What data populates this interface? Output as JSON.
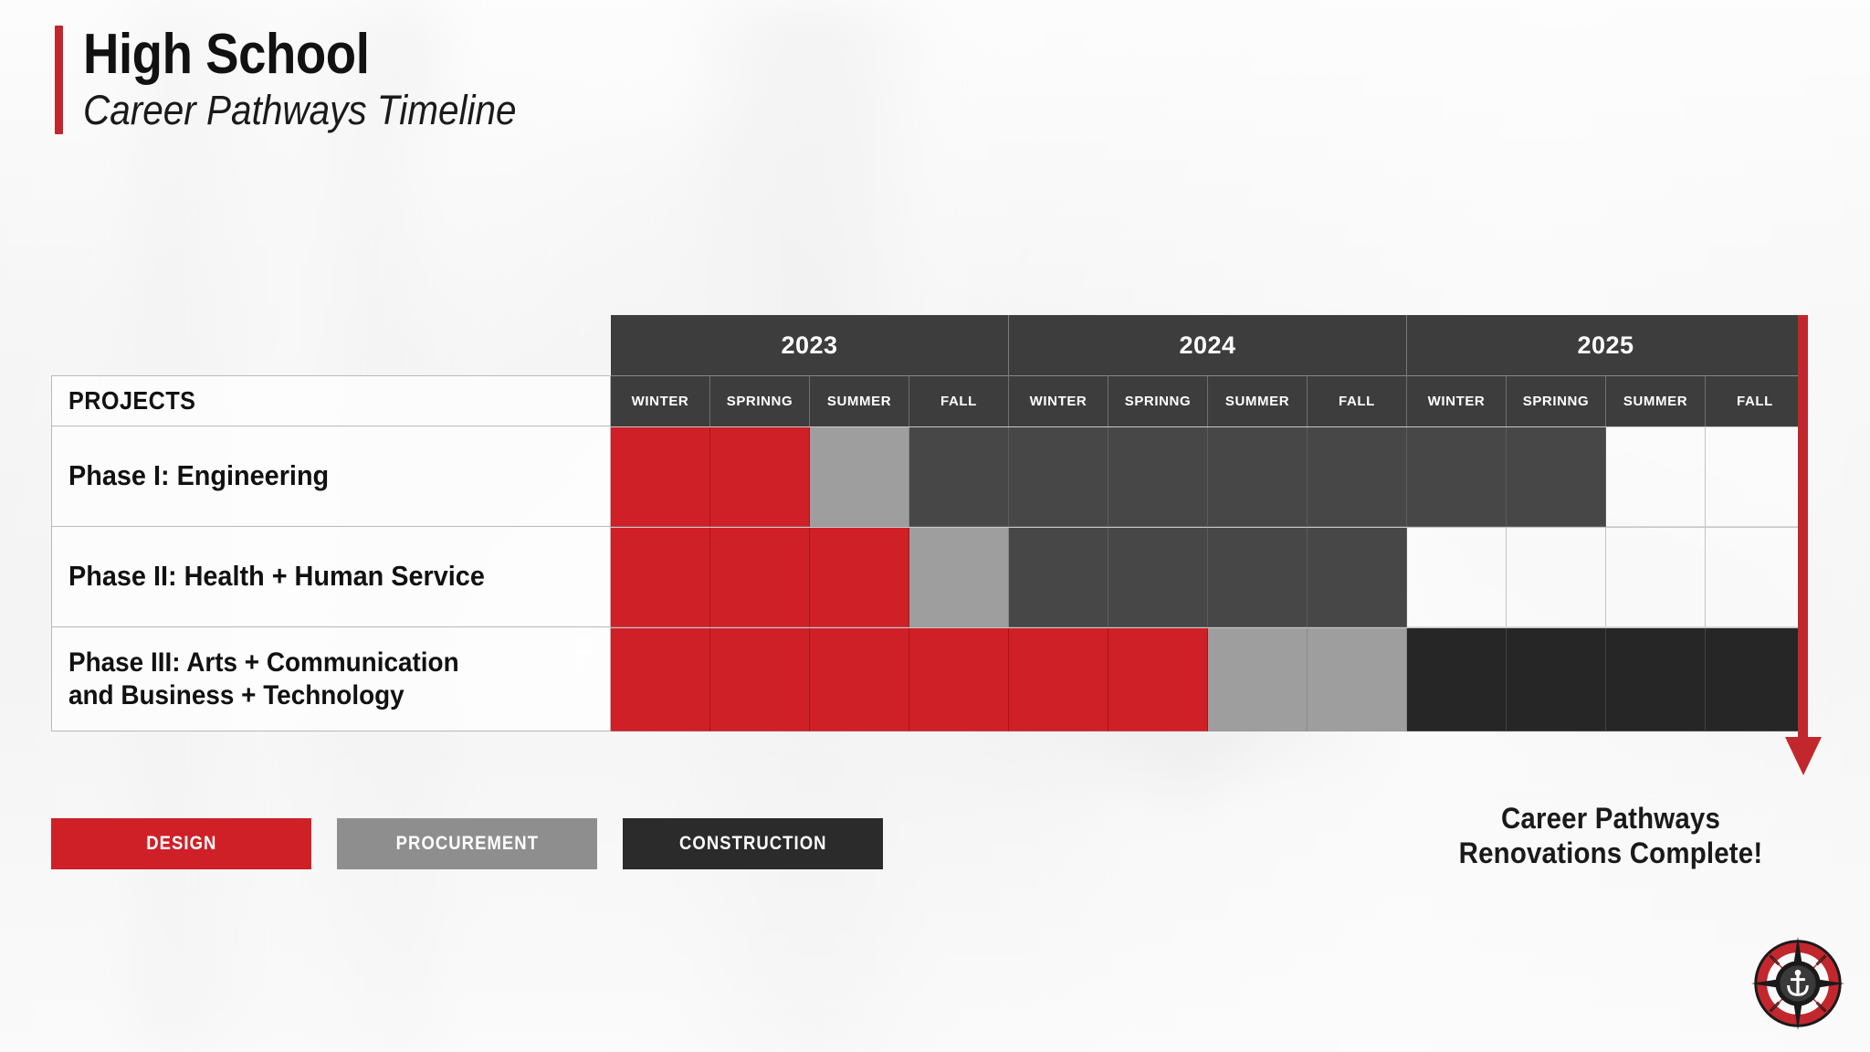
{
  "header": {
    "title": "High School",
    "subtitle": "Career Pathways Timeline",
    "accent_color": "#c1272d"
  },
  "table": {
    "projects_header": "PROJECTS",
    "years": [
      "2023",
      "2024",
      "2025"
    ],
    "seasons": [
      "WINTER",
      "SPRINNG",
      "SUMMER",
      "FALL"
    ],
    "season_columns": [
      "WINTER",
      "SPRINNG",
      "SUMMER",
      "FALL",
      "WINTER",
      "SPRINNG",
      "SUMMER",
      "FALL",
      "WINTER",
      "SPRINNG",
      "SUMMER",
      "FALL"
    ],
    "rows": [
      {
        "label": "Phase I: Engineering",
        "cells": [
          "design",
          "design",
          "procurement",
          "construction",
          "construction",
          "construction",
          "construction",
          "construction",
          "construction",
          "construction",
          "empty",
          "empty"
        ]
      },
      {
        "label": "Phase II: Health + Human Service",
        "cells": [
          "design",
          "design",
          "design",
          "procurement",
          "construction",
          "construction",
          "construction",
          "construction",
          "empty",
          "empty",
          "empty",
          "empty"
        ]
      },
      {
        "label": "Phase III: Arts + Communication and Business + Technology",
        "label_line1": "Phase III: Arts + Communication",
        "label_line2": "and Business + Technology",
        "cells": [
          "design",
          "design",
          "design",
          "design",
          "design",
          "design",
          "procurement",
          "procurement",
          "construction-dark",
          "construction-dark",
          "construction-dark",
          "construction-dark"
        ]
      }
    ]
  },
  "legend": [
    {
      "label": "DESIGN",
      "color": "#cf2027",
      "key": "design"
    },
    {
      "label": "PROCUREMENT",
      "color": "#8e8e8e",
      "key": "procurement"
    },
    {
      "label": "CONSTRUCTION",
      "color": "#2b2b2b",
      "key": "construction"
    }
  ],
  "completion_note": {
    "line1": "Career Pathways",
    "line2": "Renovations Complete!"
  },
  "arrow": {
    "name": "timeline-end-arrow",
    "color": "#c1272d"
  },
  "logo": {
    "name": "compass-anchor-logo",
    "ring_color": "#c1272d",
    "dark_color": "#1a1a1a"
  },
  "chart_data": {
    "type": "bar",
    "title": "High School Career Pathways Timeline",
    "categories": [
      "2023 WINTER",
      "2023 SPRINNG",
      "2023 SUMMER",
      "2023 FALL",
      "2024 WINTER",
      "2024 SPRINNG",
      "2024 SUMMER",
      "2024 FALL",
      "2025 WINTER",
      "2025 SPRINNG",
      "2025 SUMMER",
      "2025 FALL"
    ],
    "series": [
      {
        "name": "Phase I: Engineering",
        "values": [
          "design",
          "design",
          "procurement",
          "construction",
          "construction",
          "construction",
          "construction",
          "construction",
          "construction",
          "construction",
          "",
          ""
        ]
      },
      {
        "name": "Phase II: Health + Human Service",
        "values": [
          "design",
          "design",
          "design",
          "procurement",
          "construction",
          "construction",
          "construction",
          "construction",
          "",
          "",
          "",
          ""
        ]
      },
      {
        "name": "Phase III: Arts + Communication and Business + Technology",
        "values": [
          "design",
          "design",
          "design",
          "design",
          "design",
          "design",
          "procurement",
          "procurement",
          "construction",
          "construction",
          "construction",
          "construction"
        ]
      }
    ],
    "legend_entries": [
      "DESIGN",
      "PROCUREMENT",
      "CONSTRUCTION"
    ],
    "legend_position": "bottom-left",
    "xlabel": "",
    "ylabel": "PROJECTS",
    "grid": true,
    "annotation": "Career Pathways Renovations Complete!"
  }
}
